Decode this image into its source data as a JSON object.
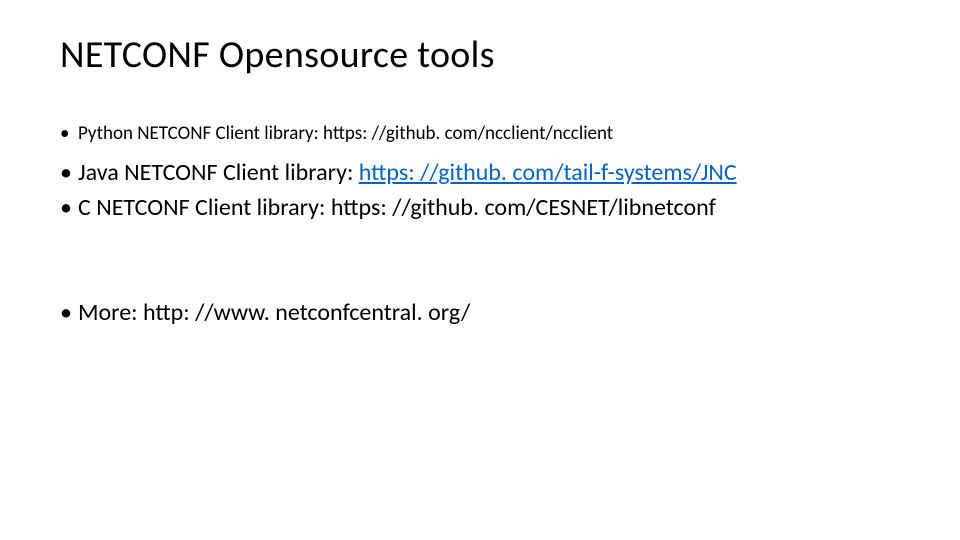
{
  "title": "NETCONF Opensource tools",
  "bullets": {
    "item0": {
      "label": "Python NETCONF Client library: ",
      "url": "https: //github. com/ncclient/ncclient"
    },
    "item1": {
      "label": "Java NETCONF Client library: ",
      "url": "https: //github. com/tail-f-systems/JNC"
    },
    "item2": {
      "label": "C NETCONF Client library: ",
      "url": "https: //github. com/CESNET/libnetconf"
    },
    "item3": {
      "label": "More: ",
      "url": "http: //www. netconfcentral. org/"
    }
  }
}
